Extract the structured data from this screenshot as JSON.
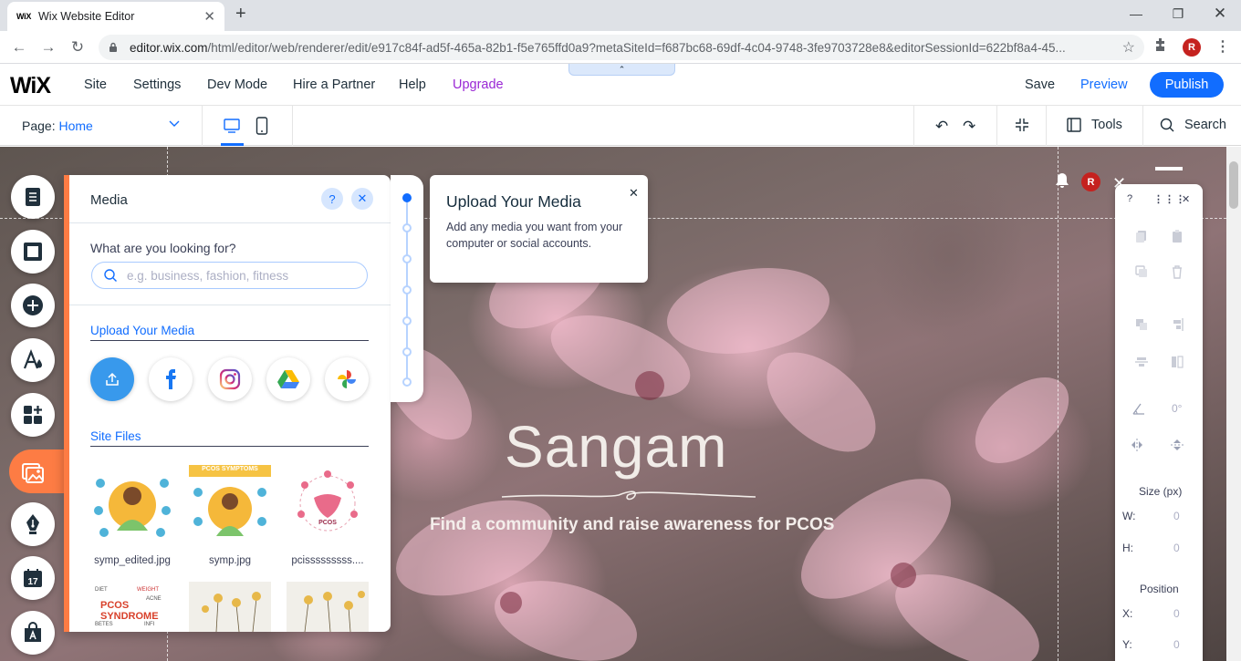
{
  "browser": {
    "tab_title": "Wix Website Editor",
    "tab_favicon": "WiX",
    "url_host": "editor.wix.com",
    "url_path": "/html/editor/web/renderer/edit/e917c84f-ad5f-465a-82b1-f5e765ffd0a9?metaSiteId=f687bc68-69df-4c04-9748-3fe9703728e8&editorSessionId=622bf8a4-45...",
    "profile_initial": "R"
  },
  "topbar": {
    "logo": "WiX",
    "menu": [
      "Site",
      "Settings",
      "Dev Mode",
      "Hire a Partner",
      "Help",
      "Upgrade"
    ],
    "save_label": "Save",
    "preview_label": "Preview",
    "publish_label": "Publish",
    "collapse_glyph": "⌃"
  },
  "pagebar": {
    "page_prefix": "Page: ",
    "page_name": "Home",
    "tools_label": "Tools",
    "search_label": "Search"
  },
  "site": {
    "title": "Sangam",
    "tagline": "Find a community and raise awareness for PCOS",
    "avatar_initial": "R"
  },
  "media_panel": {
    "title": "Media",
    "help_glyph": "?",
    "close_glyph": "✕",
    "search_label": "What are you looking for?",
    "search_placeholder": "e.g. business, fashion, fitness",
    "upload_section": "Upload Your Media",
    "site_files_section": "Site Files",
    "files": [
      "symp_edited.jpg",
      "symp.jpg",
      "pcisssssssss...."
    ],
    "thumb_badge_text": "PCOS SYMPTOMS",
    "thumb_pcos_text": "PCOS",
    "thumb_wordcloud": "PCOS SYNDROME"
  },
  "tooltip": {
    "title": "Upload Your Media",
    "body": "Add any media you want from your computer or social accounts.",
    "close_glyph": "✕"
  },
  "inspector": {
    "help_glyph": "?",
    "close_glyph": "✕",
    "rotation": "0°",
    "size_title": "Size (px)",
    "w_label": "W:",
    "w_value": "0",
    "h_label": "H:",
    "h_value": "0",
    "position_title": "Position",
    "x_label": "X:",
    "x_value": "0",
    "y_label": "Y:",
    "y_value": "0"
  },
  "colors": {
    "accent_blue": "#116dff",
    "upgrade_purple": "#9a27d5",
    "media_orange": "#fd7c44"
  },
  "icons": {
    "rail": [
      "pages-icon",
      "section-icon",
      "add-icon",
      "theme-icon",
      "apps-icon",
      "media-icon",
      "blog-pen-icon",
      "bookings-icon",
      "store-icon"
    ],
    "upload_sources": [
      "upload-icon",
      "facebook-icon",
      "instagram-icon",
      "google-drive-icon",
      "google-photos-icon"
    ]
  }
}
